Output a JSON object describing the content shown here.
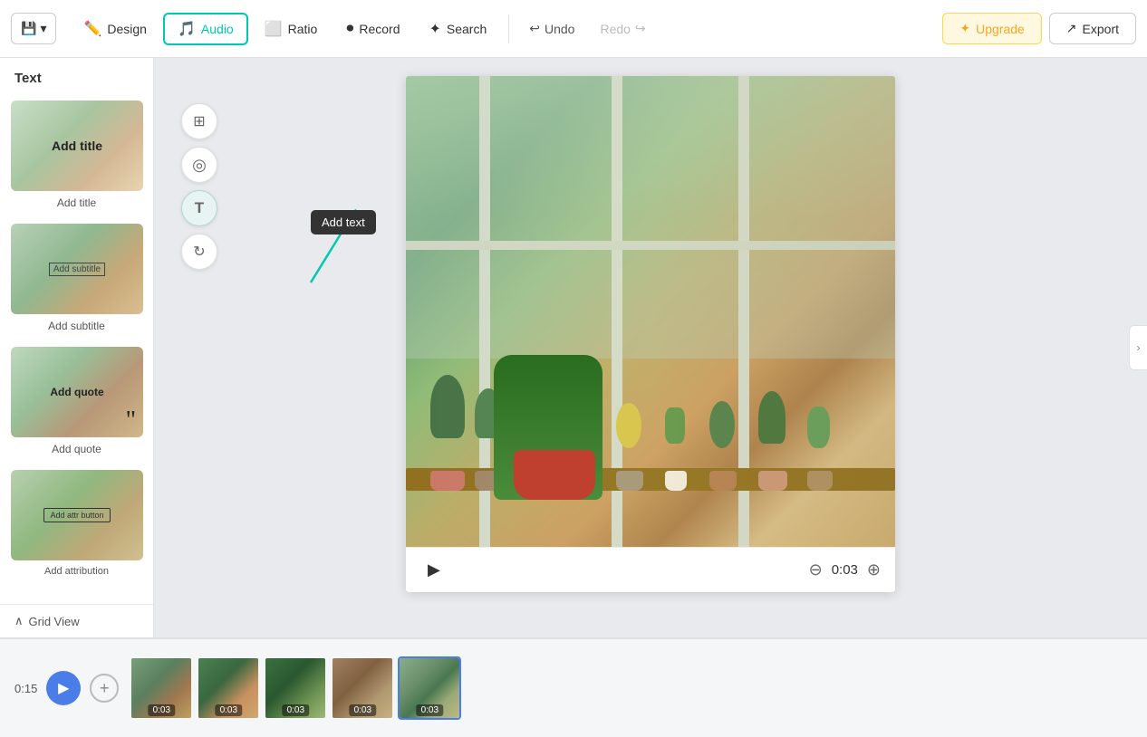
{
  "toolbar": {
    "save_label": "Save",
    "design_label": "Design",
    "audio_label": "Audio",
    "ratio_label": "Ratio",
    "record_label": "Record",
    "search_label": "Search",
    "undo_label": "Undo",
    "redo_label": "Redo",
    "upgrade_label": "Upgrade",
    "export_label": "Export"
  },
  "left_panel": {
    "header": "Text",
    "items": [
      {
        "label": "Add title",
        "overlay": "Add title",
        "type": "title"
      },
      {
        "label": "Add subtitle",
        "overlay": "Add subtitle",
        "type": "subtitle"
      },
      {
        "label": "Add quote",
        "overlay": "Add quote",
        "type": "quote"
      },
      {
        "label": "Add attribution",
        "overlay": "Add attr button",
        "type": "button"
      }
    ],
    "grid_view_label": "Grid View"
  },
  "vertical_tools": {
    "layout_icon": "⊞",
    "color_icon": "◎",
    "text_icon": "T",
    "animation_icon": "↻",
    "tooltip_text": "Add text"
  },
  "canvas": {
    "time_display": "0:03",
    "play_icon": "▶"
  },
  "filmstrip": {
    "total_time": "0:15",
    "clips": [
      {
        "duration": "0:03",
        "active": false,
        "bg_color": "#7a9e7a"
      },
      {
        "duration": "0:03",
        "active": false,
        "bg_color": "#6a8e6a"
      },
      {
        "duration": "0:03",
        "active": false,
        "bg_color": "#8aae6a"
      },
      {
        "duration": "0:03",
        "active": false,
        "bg_color": "#9a9a7a"
      },
      {
        "duration": "0:03",
        "active": true,
        "bg_color": "#7a8e9a"
      }
    ]
  },
  "colors": {
    "accent_teal": "#00c9b1",
    "accent_blue": "#4a7de8",
    "accent_gold": "#f5a623",
    "toolbar_bg": "#ffffff",
    "panel_bg": "#ffffff",
    "canvas_bg": "#e8eaed"
  }
}
